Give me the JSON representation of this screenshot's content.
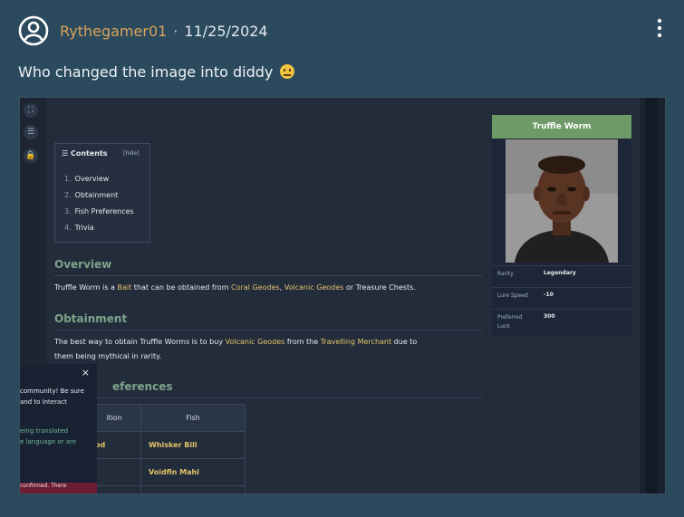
{
  "post": {
    "username": "Rythegamer01",
    "separator": "·",
    "date": "11/25/2024",
    "message": "Who changed the image into diddy"
  },
  "wiki": {
    "contents": {
      "title": "Contents",
      "hide": "[hide]",
      "items": [
        {
          "num": "1.",
          "label": "Overview"
        },
        {
          "num": "2.",
          "label": "Obtainment"
        },
        {
          "num": "3.",
          "label": "Fish Preferences"
        },
        {
          "num": "4.",
          "label": "Trivia"
        }
      ]
    },
    "overview": {
      "heading": "Overview",
      "p1": "Truffle Worm is a",
      "link_bait": "Bait",
      "p2": "that can be obtained from",
      "link_coral": "Coral Geodes",
      "comma": ",",
      "link_volcanic": "Volcanic Geodes",
      "p3": "or Treasure Chests."
    },
    "obtainment": {
      "heading": "Obtainment",
      "p1": "The best way to obtain Truffle Worms is to buy",
      "link_volcanic": "Volcanic Geodes",
      "p2": "from the",
      "link_merchant": "Travelling Merchant",
      "p3": "due to",
      "p4": "them being mythical in rarity."
    },
    "fish_pref": {
      "heading_partial": "eferences",
      "col1": "ition",
      "col2": "Fish",
      "rows": [
        {
          "c1": "od",
          "c2": "Whisker Bill"
        },
        {
          "c1": "",
          "c2": "Voidfin Mahi"
        },
        {
          "c1": "",
          "c2": ""
        }
      ]
    },
    "popup": {
      "close": "×",
      "line1": "community! Be sure",
      "line2": "and to interact",
      "line3": "eing translated",
      "line4": "e language or are",
      "bottom": "confirmed. There"
    },
    "infobox": {
      "title": "Truffle Worm",
      "rows": [
        {
          "label": "Rarity",
          "value": "Legendary"
        },
        {
          "label": "Lure Speed",
          "value": "-10"
        },
        {
          "label": "Preferred Luck",
          "value": "300"
        }
      ]
    }
  },
  "colors": {
    "background": "#2c4a5e",
    "username": "#d9a35a",
    "link": "#e3c56a",
    "heading": "#7ea48a",
    "infobox_title": "#6d9a66"
  }
}
